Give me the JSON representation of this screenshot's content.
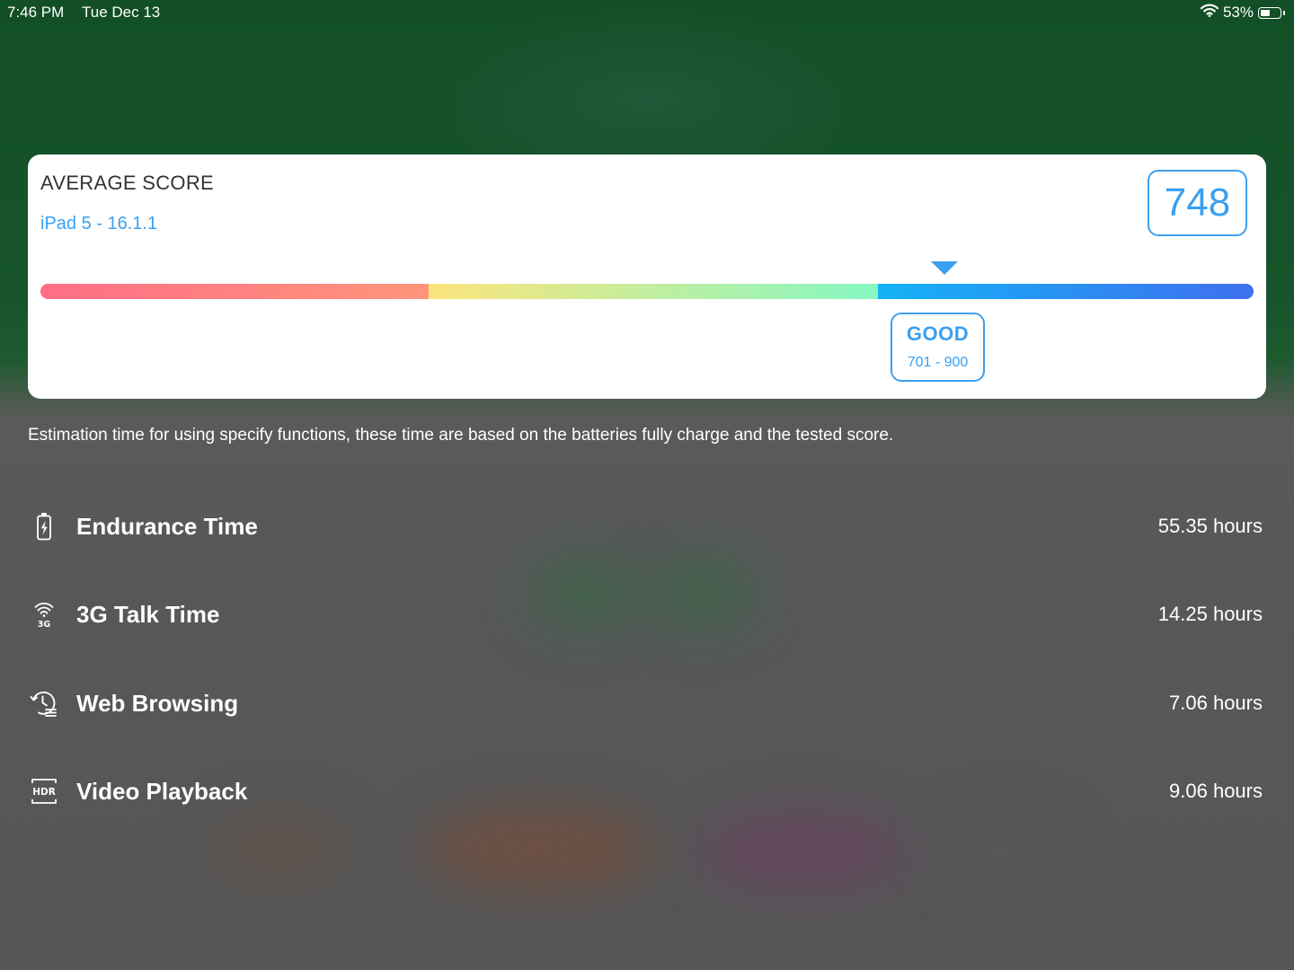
{
  "status_bar": {
    "time": "7:46 PM",
    "date": "Tue Dec 13",
    "battery_percent": "53%",
    "battery_level": 0.53,
    "icons": [
      "wifi-icon",
      "battery-icon"
    ]
  },
  "score_card": {
    "title": "AVERAGE SCORE",
    "device": "iPad 5 - 16.1.1",
    "score": "748",
    "score_value": 748,
    "pointer_fraction": 0.7455,
    "gauge": {
      "min": 0,
      "max": 1200,
      "segments": [
        {
          "fraction": 0.32,
          "from_color": "#ff6e86",
          "to_color": "#ff957a"
        },
        {
          "fraction": 0.37,
          "from_color": "#fde47c",
          "to_color": "#86f7c2"
        },
        {
          "fraction": 0.31,
          "from_color": "#14b2f6",
          "to_color": "#3f6ff0"
        }
      ]
    },
    "grade": {
      "label": "GOOD",
      "range": "701 - 900"
    },
    "accent_color": "#3aa0f0"
  },
  "description": "Estimation time for using specify functions, these time are based on the batteries fully charge and the tested score.",
  "metrics": [
    {
      "icon": "battery-charging-icon",
      "label": "Endurance Time",
      "value": "55.35 hours"
    },
    {
      "icon": "3g-signal-icon",
      "label": "3G Talk Time",
      "value": "14.25 hours"
    },
    {
      "icon": "history-icon",
      "label": "Web Browsing",
      "value": "7.06 hours"
    },
    {
      "icon": "hdr-icon",
      "label": "Video Playback",
      "value": "9.06 hours"
    }
  ]
}
